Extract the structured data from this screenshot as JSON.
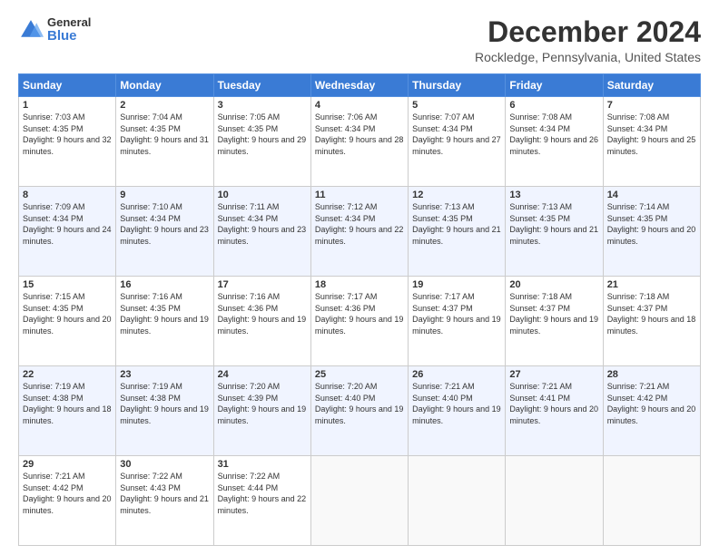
{
  "header": {
    "logo": {
      "general": "General",
      "blue": "Blue"
    },
    "title": "December 2024",
    "subtitle": "Rockledge, Pennsylvania, United States"
  },
  "calendar": {
    "headers": [
      "Sunday",
      "Monday",
      "Tuesday",
      "Wednesday",
      "Thursday",
      "Friday",
      "Saturday"
    ],
    "weeks": [
      [
        {
          "day": "1",
          "sunrise": "Sunrise: 7:03 AM",
          "sunset": "Sunset: 4:35 PM",
          "daylight": "Daylight: 9 hours and 32 minutes."
        },
        {
          "day": "2",
          "sunrise": "Sunrise: 7:04 AM",
          "sunset": "Sunset: 4:35 PM",
          "daylight": "Daylight: 9 hours and 31 minutes."
        },
        {
          "day": "3",
          "sunrise": "Sunrise: 7:05 AM",
          "sunset": "Sunset: 4:35 PM",
          "daylight": "Daylight: 9 hours and 29 minutes."
        },
        {
          "day": "4",
          "sunrise": "Sunrise: 7:06 AM",
          "sunset": "Sunset: 4:34 PM",
          "daylight": "Daylight: 9 hours and 28 minutes."
        },
        {
          "day": "5",
          "sunrise": "Sunrise: 7:07 AM",
          "sunset": "Sunset: 4:34 PM",
          "daylight": "Daylight: 9 hours and 27 minutes."
        },
        {
          "day": "6",
          "sunrise": "Sunrise: 7:08 AM",
          "sunset": "Sunset: 4:34 PM",
          "daylight": "Daylight: 9 hours and 26 minutes."
        },
        {
          "day": "7",
          "sunrise": "Sunrise: 7:08 AM",
          "sunset": "Sunset: 4:34 PM",
          "daylight": "Daylight: 9 hours and 25 minutes."
        }
      ],
      [
        {
          "day": "8",
          "sunrise": "Sunrise: 7:09 AM",
          "sunset": "Sunset: 4:34 PM",
          "daylight": "Daylight: 9 hours and 24 minutes."
        },
        {
          "day": "9",
          "sunrise": "Sunrise: 7:10 AM",
          "sunset": "Sunset: 4:34 PM",
          "daylight": "Daylight: 9 hours and 23 minutes."
        },
        {
          "day": "10",
          "sunrise": "Sunrise: 7:11 AM",
          "sunset": "Sunset: 4:34 PM",
          "daylight": "Daylight: 9 hours and 23 minutes."
        },
        {
          "day": "11",
          "sunrise": "Sunrise: 7:12 AM",
          "sunset": "Sunset: 4:34 PM",
          "daylight": "Daylight: 9 hours and 22 minutes."
        },
        {
          "day": "12",
          "sunrise": "Sunrise: 7:13 AM",
          "sunset": "Sunset: 4:35 PM",
          "daylight": "Daylight: 9 hours and 21 minutes."
        },
        {
          "day": "13",
          "sunrise": "Sunrise: 7:13 AM",
          "sunset": "Sunset: 4:35 PM",
          "daylight": "Daylight: 9 hours and 21 minutes."
        },
        {
          "day": "14",
          "sunrise": "Sunrise: 7:14 AM",
          "sunset": "Sunset: 4:35 PM",
          "daylight": "Daylight: 9 hours and 20 minutes."
        }
      ],
      [
        {
          "day": "15",
          "sunrise": "Sunrise: 7:15 AM",
          "sunset": "Sunset: 4:35 PM",
          "daylight": "Daylight: 9 hours and 20 minutes."
        },
        {
          "day": "16",
          "sunrise": "Sunrise: 7:16 AM",
          "sunset": "Sunset: 4:35 PM",
          "daylight": "Daylight: 9 hours and 19 minutes."
        },
        {
          "day": "17",
          "sunrise": "Sunrise: 7:16 AM",
          "sunset": "Sunset: 4:36 PM",
          "daylight": "Daylight: 9 hours and 19 minutes."
        },
        {
          "day": "18",
          "sunrise": "Sunrise: 7:17 AM",
          "sunset": "Sunset: 4:36 PM",
          "daylight": "Daylight: 9 hours and 19 minutes."
        },
        {
          "day": "19",
          "sunrise": "Sunrise: 7:17 AM",
          "sunset": "Sunset: 4:37 PM",
          "daylight": "Daylight: 9 hours and 19 minutes."
        },
        {
          "day": "20",
          "sunrise": "Sunrise: 7:18 AM",
          "sunset": "Sunset: 4:37 PM",
          "daylight": "Daylight: 9 hours and 19 minutes."
        },
        {
          "day": "21",
          "sunrise": "Sunrise: 7:18 AM",
          "sunset": "Sunset: 4:37 PM",
          "daylight": "Daylight: 9 hours and 18 minutes."
        }
      ],
      [
        {
          "day": "22",
          "sunrise": "Sunrise: 7:19 AM",
          "sunset": "Sunset: 4:38 PM",
          "daylight": "Daylight: 9 hours and 18 minutes."
        },
        {
          "day": "23",
          "sunrise": "Sunrise: 7:19 AM",
          "sunset": "Sunset: 4:38 PM",
          "daylight": "Daylight: 9 hours and 19 minutes."
        },
        {
          "day": "24",
          "sunrise": "Sunrise: 7:20 AM",
          "sunset": "Sunset: 4:39 PM",
          "daylight": "Daylight: 9 hours and 19 minutes."
        },
        {
          "day": "25",
          "sunrise": "Sunrise: 7:20 AM",
          "sunset": "Sunset: 4:40 PM",
          "daylight": "Daylight: 9 hours and 19 minutes."
        },
        {
          "day": "26",
          "sunrise": "Sunrise: 7:21 AM",
          "sunset": "Sunset: 4:40 PM",
          "daylight": "Daylight: 9 hours and 19 minutes."
        },
        {
          "day": "27",
          "sunrise": "Sunrise: 7:21 AM",
          "sunset": "Sunset: 4:41 PM",
          "daylight": "Daylight: 9 hours and 20 minutes."
        },
        {
          "day": "28",
          "sunrise": "Sunrise: 7:21 AM",
          "sunset": "Sunset: 4:42 PM",
          "daylight": "Daylight: 9 hours and 20 minutes."
        }
      ],
      [
        {
          "day": "29",
          "sunrise": "Sunrise: 7:21 AM",
          "sunset": "Sunset: 4:42 PM",
          "daylight": "Daylight: 9 hours and 20 minutes."
        },
        {
          "day": "30",
          "sunrise": "Sunrise: 7:22 AM",
          "sunset": "Sunset: 4:43 PM",
          "daylight": "Daylight: 9 hours and 21 minutes."
        },
        {
          "day": "31",
          "sunrise": "Sunrise: 7:22 AM",
          "sunset": "Sunset: 4:44 PM",
          "daylight": "Daylight: 9 hours and 22 minutes."
        },
        null,
        null,
        null,
        null
      ]
    ]
  }
}
